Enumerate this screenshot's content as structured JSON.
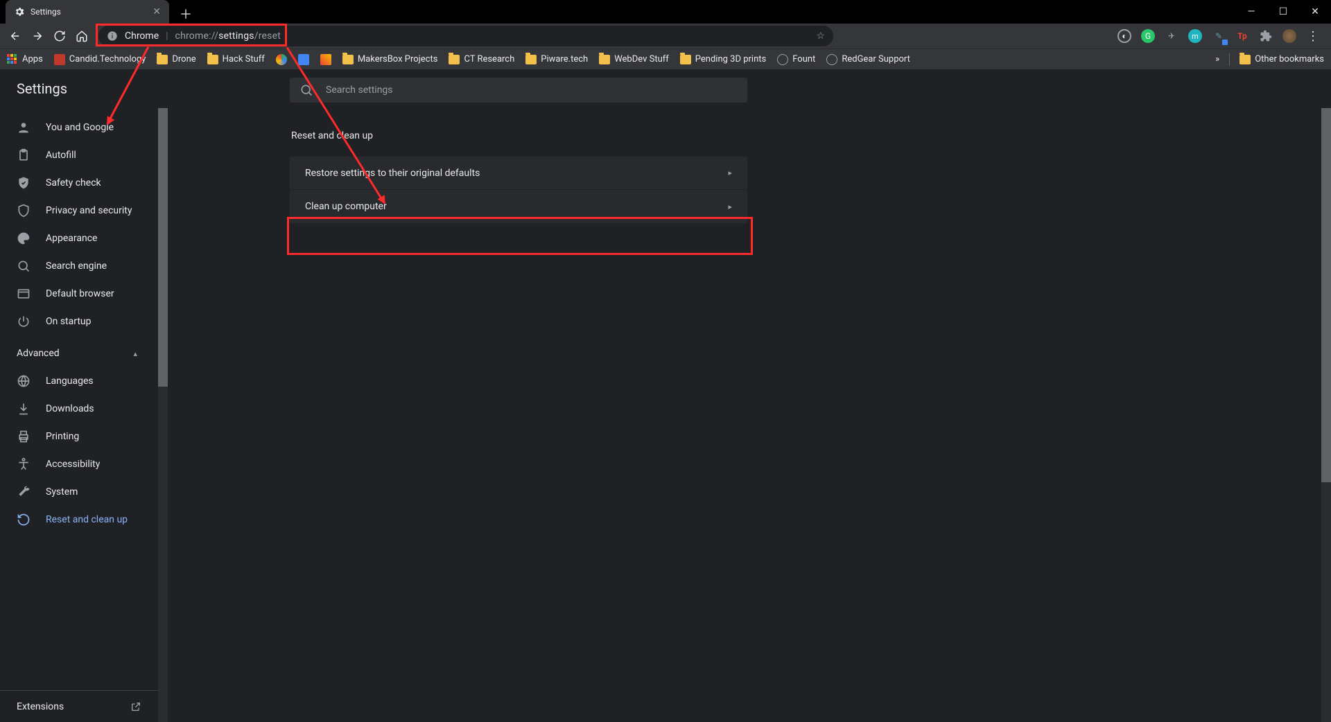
{
  "tab": {
    "title": "Settings"
  },
  "omnibox": {
    "chip": "Chrome",
    "url_prefix": "chrome://",
    "url_mid": "settings",
    "url_suffix": "/reset"
  },
  "bookmarks": {
    "apps": "Apps",
    "items": [
      "Candid.Technology",
      "Drone",
      "Hack Stuff",
      "",
      "",
      "",
      "MakersBox Projects",
      "CT Research",
      "Piware.tech",
      "WebDev Stuff",
      "Pending 3D prints",
      "Fount",
      "RedGear Support"
    ],
    "overflow": "»",
    "other": "Other bookmarks"
  },
  "settings": {
    "title": "Settings",
    "search_placeholder": "Search settings",
    "sidebar": {
      "items": [
        "You and Google",
        "Autofill",
        "Safety check",
        "Privacy and security",
        "Appearance",
        "Search engine",
        "Default browser",
        "On startup"
      ],
      "advanced": "Advanced",
      "adv_items": [
        "Languages",
        "Downloads",
        "Printing",
        "Accessibility",
        "System",
        "Reset and clean up"
      ],
      "extensions": "Extensions"
    },
    "main": {
      "heading": "Reset and clean up",
      "rows": [
        "Restore settings to their original defaults",
        "Clean up computer"
      ]
    }
  }
}
